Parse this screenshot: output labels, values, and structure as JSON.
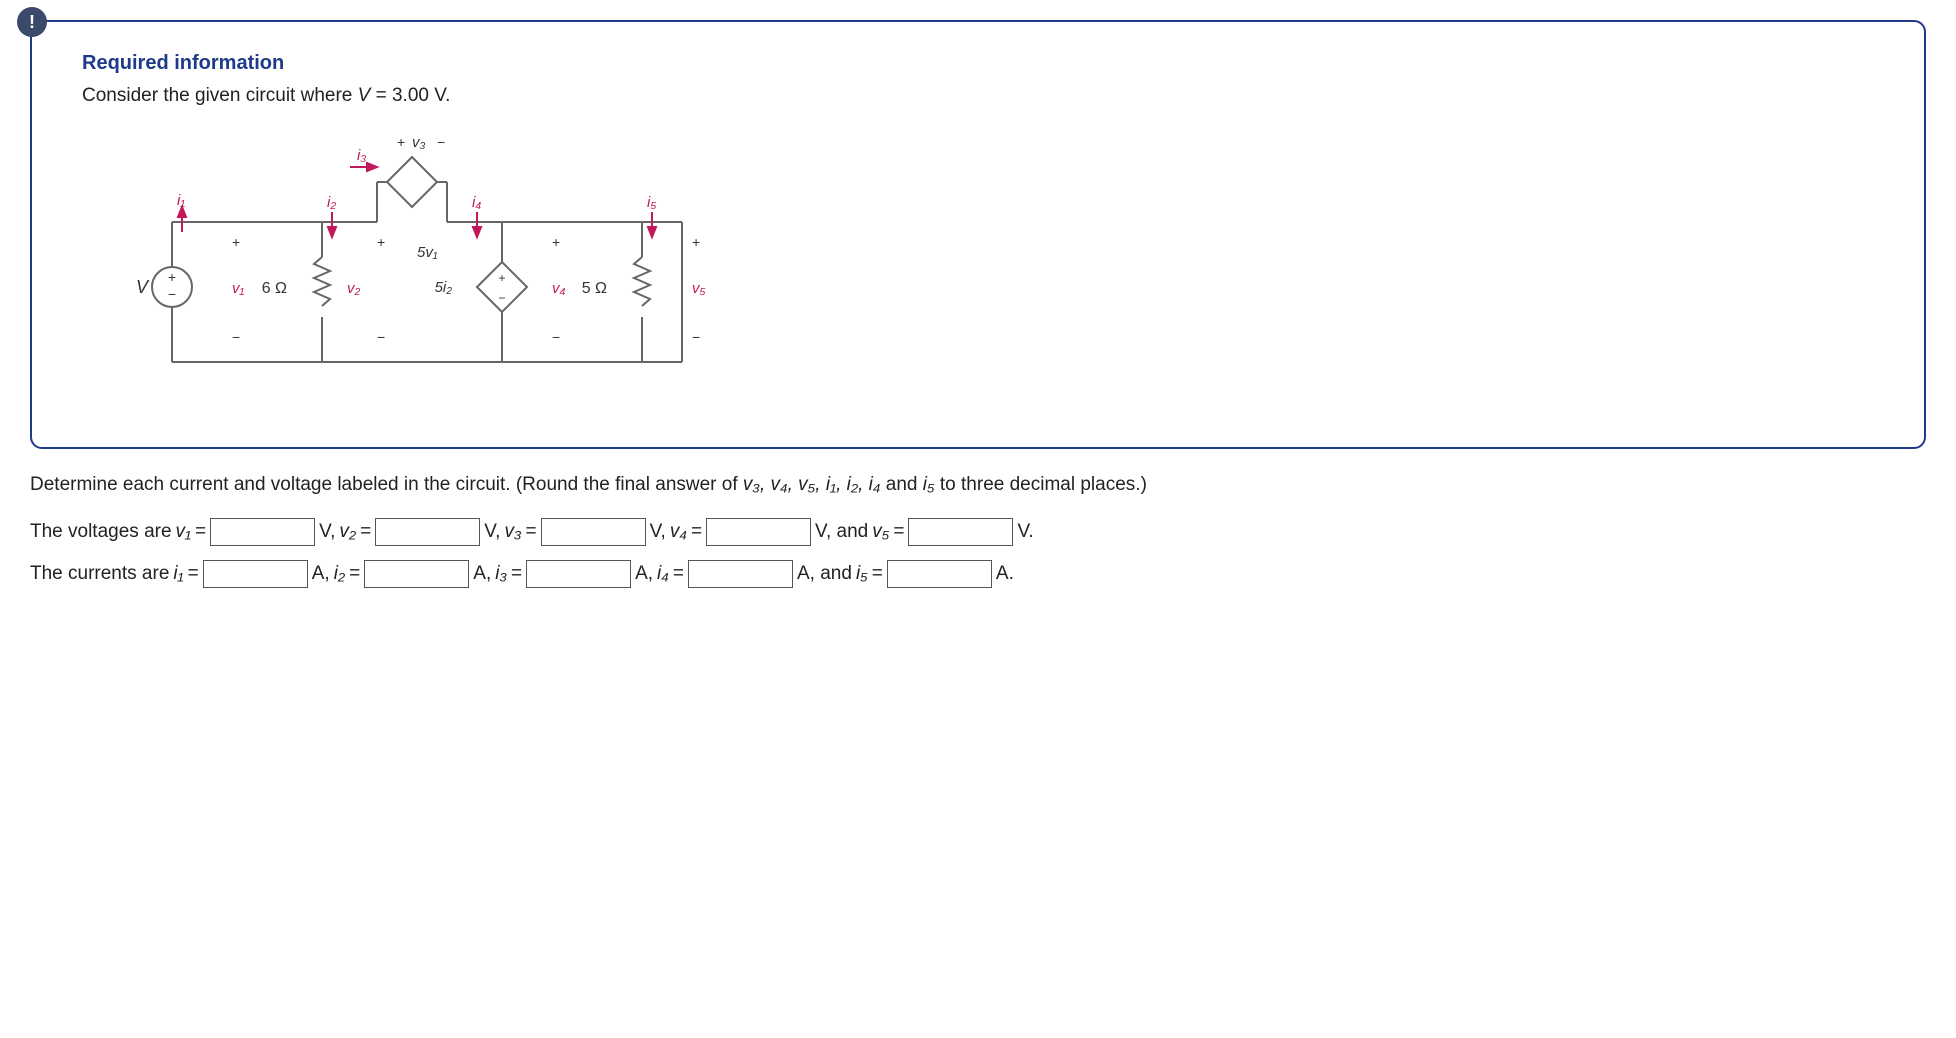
{
  "info_box": {
    "badge": "!",
    "title": "Required information",
    "prompt_prefix": "Consider the given circuit where ",
    "prompt_var": "V",
    "prompt_eq": " = 3.00 V."
  },
  "circuit": {
    "source_label": "V",
    "i1": "i₁",
    "i2": "i₂",
    "i3": "i₃",
    "i4": "i₄",
    "i5": "i₅",
    "v1": "v₁",
    "v2": "v₂",
    "v3": "v₃",
    "v4": "v₄",
    "v5": "v₅",
    "r_left": "6 Ω",
    "r_right": "5 Ω",
    "dep_v_label": "5v₁",
    "dep_i_label": "5i₂"
  },
  "question": {
    "text_start": "Determine each current and voltage labeled in the circuit. (Round the final answer of ",
    "vars": "v₃, v₄, v₅, i₁, i₂, i₄",
    "and": " and ",
    "last_var": "i₅",
    "text_end": " to three decimal places.)"
  },
  "voltages_row": {
    "lead": "The voltages are ",
    "v1_lbl": "v₁",
    "v2_lbl": "v₂",
    "v3_lbl": "v₃",
    "v4_lbl": "v₄",
    "v5_lbl": "v₅",
    "eq": " = ",
    "unit_comma": " V, ",
    "unit_and": " V, and ",
    "unit_end": " V."
  },
  "currents_row": {
    "lead": "The currents are ",
    "i1_lbl": "i₁",
    "i2_lbl": "i₂",
    "i3_lbl": "i₃",
    "i4_lbl": "i₄",
    "i5_lbl": "i₅",
    "eq": " = ",
    "unit_comma": " A, ",
    "unit_and": " A, and ",
    "unit_end": " A."
  }
}
